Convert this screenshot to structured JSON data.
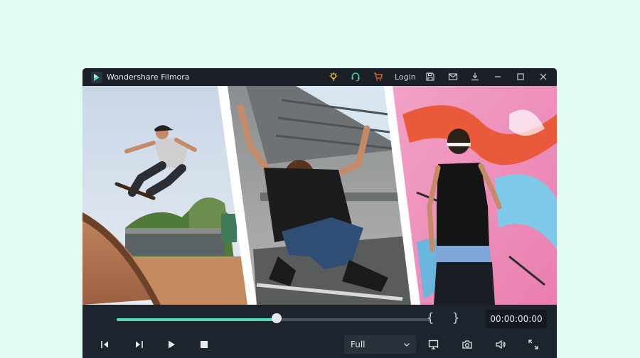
{
  "window": {
    "title": "Wondershare Filmora",
    "login_label": "Login",
    "icons": [
      "bulb-icon",
      "headset-icon",
      "cart-icon",
      "save-icon",
      "mail-icon",
      "download-icon",
      "minimize-icon",
      "maximize-icon",
      "close-icon"
    ]
  },
  "colors": {
    "accent": "#4fdcb5",
    "bulb": "#f0c419",
    "headset": "#3ecfa7",
    "cart": "#f26b2a",
    "background": "#e1fbf2",
    "window": "#1e242d"
  },
  "preview": {
    "description_panels": [
      "skateboarder-photo",
      "woman-sitting-on-skateboard-photo",
      "man-with-graffiti-wall-photo"
    ]
  },
  "player": {
    "progress": 0.51,
    "mark_in": "{",
    "mark_out": "}",
    "timecode": "00:00:00:00",
    "zoom_option": "Full",
    "buttons": [
      "previous-frame",
      "next-frame",
      "play",
      "stop",
      "display",
      "snapshot",
      "volume",
      "fullscreen"
    ]
  }
}
